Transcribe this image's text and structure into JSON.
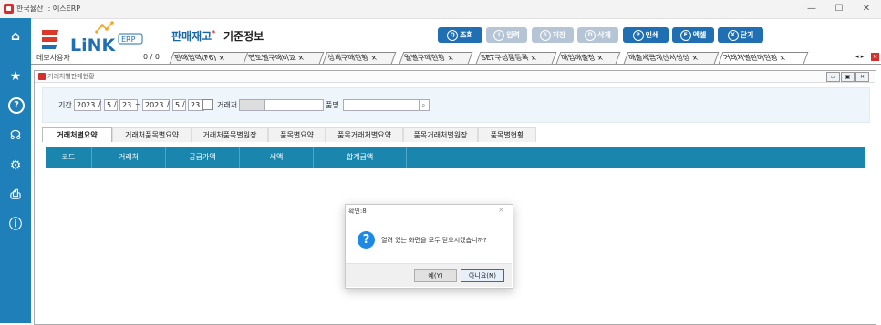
{
  "window": {
    "title": "한국율산 :: 예스ERP",
    "minimize": "—",
    "maximize": "☐",
    "close": "✕"
  },
  "sidebar": {
    "icons": [
      "home-icon",
      "star-icon",
      "help-icon",
      "headset-icon",
      "settings-icon",
      "printer-icon",
      "info-icon"
    ],
    "glyphs": [
      "⌂",
      "★",
      "?",
      "☊",
      "⚙",
      "⎙",
      "ⓘ"
    ]
  },
  "header": {
    "logo_text": "LiNK",
    "logo_badge": "ERP",
    "module": "판매재고",
    "module_mark": "*",
    "section": "기준정보",
    "buttons": [
      {
        "key": "Q",
        "label": "조회",
        "enabled": true
      },
      {
        "key": "I",
        "label": "입력",
        "enabled": false
      },
      {
        "key": "S",
        "label": "저장",
        "enabled": false
      },
      {
        "key": "D",
        "label": "삭제",
        "enabled": false
      },
      {
        "key": "P",
        "label": "인쇄",
        "enabled": true
      },
      {
        "key": "E",
        "label": "엑셀",
        "enabled": true
      },
      {
        "key": "X",
        "label": "닫기",
        "enabled": true
      }
    ]
  },
  "tabs_row": {
    "user": "데모사용자",
    "page_count": "0 / 0",
    "tabs": [
      "판매입력(F6)",
      "연도별구매비교",
      "상세구매현황",
      "월별구매현황",
      "SET구성품등록",
      "매입매출장",
      "매출세금계산서생성",
      "거래처별판매현황"
    ],
    "close": "×",
    "arrows": "◂ ▸"
  },
  "inner": {
    "title": "거래처별판매현황"
  },
  "search": {
    "period_label": "기간",
    "from_year": "2023",
    "from_month": "5",
    "from_day": "23",
    "tilde": "~",
    "to_year": "2023",
    "to_month": "5",
    "to_day": "23",
    "slash": "/",
    "partner_label": "거래처",
    "item_label": "품명"
  },
  "view_tabs": [
    "거래처별요약",
    "거래처품목별요약",
    "거래처품목별원장",
    "품목별요약",
    "품목거래처별요약",
    "품목거래처별원장",
    "품목별현황"
  ],
  "grid": {
    "columns": [
      "코드",
      "거래처",
      "공급가액",
      "세액",
      "합계금액"
    ]
  },
  "dialog": {
    "title": "확인:8",
    "close": "×",
    "icon": "?",
    "message": "열려 있는 화면을 모두 닫으시겠습니까?",
    "yes": "예(Y)",
    "no": "아니요(N)"
  },
  "colors": {
    "sidebar": "#1f7fb9",
    "button": "#1f6fb2",
    "grid_header": "#1a86ad",
    "accent_red": "#e53935"
  }
}
